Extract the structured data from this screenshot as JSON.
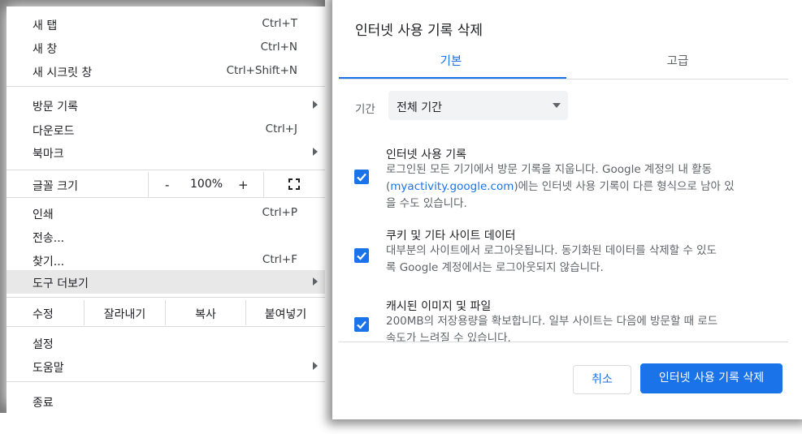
{
  "menu": {
    "new_tab": {
      "label": "새 탭",
      "shortcut": "Ctrl+T"
    },
    "new_window": {
      "label": "새 창",
      "shortcut": "Ctrl+N"
    },
    "new_incognito": {
      "label": "새 시크릿 창",
      "shortcut": "Ctrl+Shift+N"
    },
    "history": {
      "label": "방문 기록"
    },
    "downloads": {
      "label": "다운로드",
      "shortcut": "Ctrl+J"
    },
    "bookmarks": {
      "label": "북마크"
    },
    "zoom": {
      "label": "글꼴 크기",
      "minus": "-",
      "value": "100%",
      "plus": "+",
      "fullscreen_icon": "fullscreen-icon"
    },
    "print": {
      "label": "인쇄",
      "shortcut": "Ctrl+P"
    },
    "cast": {
      "label": "전송..."
    },
    "find": {
      "label": "찾기...",
      "shortcut": "Ctrl+F"
    },
    "more_tools": {
      "label": "도구 더보기"
    },
    "edit": {
      "label": "수정",
      "cut": "잘라내기",
      "copy": "복사",
      "paste": "붙여넣기"
    },
    "settings": {
      "label": "설정"
    },
    "help": {
      "label": "도움말"
    },
    "exit": {
      "label": "종료"
    }
  },
  "dialog": {
    "title": "인터넷 사용 기록 삭제",
    "tabs": {
      "basic": "기본",
      "advanced": "고급"
    },
    "time_range": {
      "label": "기간",
      "value": "전체 기간"
    },
    "options": {
      "history": {
        "title": "인터넷 사용 기록",
        "desc_1": "로그인된 모든 기기에서 방문 기록을 지웁니다. Google 계정의 내 활동",
        "desc_2_pre": "(",
        "desc_2_link": "myactivity.google.com",
        "desc_2_post": ")에는 인터넷 사용 기록이 다른 형식으로 남아 있",
        "desc_3": "을 수도 있습니다.",
        "checked": true
      },
      "cookies": {
        "title": "쿠키 및 기타 사이트 데이터",
        "desc_1": "대부분의 사이트에서 로그아웃됩니다. 동기화된 데이터를 삭제할 수 있도",
        "desc_2": "록 Google 계정에서는 로그아웃되지 않습니다.",
        "checked": true
      },
      "cache": {
        "title": "캐시된 이미지 및 파일",
        "desc_1": "200MB의 저장용량을 확보합니다. 일부 사이트는 다음에 방문할 때 로드",
        "desc_2": "속도가 느려질 수 있습니다.",
        "checked": true
      }
    },
    "buttons": {
      "cancel": "취소",
      "clear": "인터넷 사용 기록 삭제"
    }
  },
  "colors": {
    "accent": "#1a73e8",
    "highlight": "#e8e8e8"
  }
}
